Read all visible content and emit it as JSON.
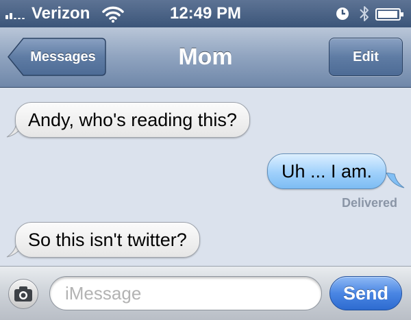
{
  "status_bar": {
    "carrier": "Verizon",
    "time": "12:49 PM",
    "signal_icon": "signal-bars-icon",
    "wifi_icon": "wifi-icon",
    "alarm_icon": "alarm-clock-icon",
    "bluetooth_icon": "bluetooth-icon",
    "battery_icon": "battery-icon"
  },
  "nav_bar": {
    "back_label": "Messages",
    "title": "Mom",
    "edit_label": "Edit"
  },
  "conversation": {
    "messages": [
      {
        "direction": "incoming",
        "text": "Andy, who's reading this?"
      },
      {
        "direction": "outgoing",
        "text": "Uh ... I am.",
        "status": "Delivered"
      },
      {
        "direction": "incoming",
        "text": "So this isn't twitter?"
      }
    ]
  },
  "input_bar": {
    "camera_icon": "camera-icon",
    "placeholder": "iMessage",
    "send_label": "Send"
  },
  "colors": {
    "nav_bar": "#7f95b5",
    "status_bar": "#3b5579",
    "background": "#dbe2ed",
    "outgoing_bubble": "#9fd0fb",
    "incoming_bubble": "#efefef",
    "send_button": "#3a78dc"
  }
}
